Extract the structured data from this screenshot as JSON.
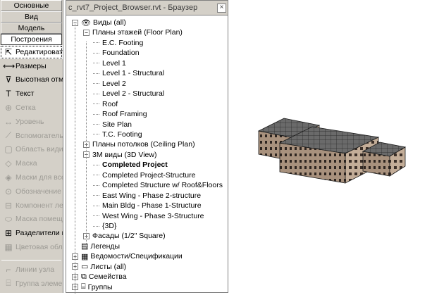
{
  "tabs": [
    "Основные",
    "Вид",
    "Модель",
    "Построения"
  ],
  "tools": [
    {
      "label": "Редактировать",
      "icon": "cursor-arrow-icon",
      "glyph": "⇱",
      "state": "selected"
    },
    {
      "label": "Размеры",
      "icon": "dimension-icon",
      "glyph": "⟷",
      "state": "enabled"
    },
    {
      "label": "Высотная отм",
      "icon": "spot-elevation-icon",
      "glyph": "⊽",
      "state": "enabled"
    },
    {
      "label": "Текст",
      "icon": "text-icon",
      "glyph": "T",
      "state": "enabled"
    },
    {
      "label": "Сетка",
      "icon": "grid-icon",
      "glyph": "⊕",
      "state": "disabled"
    },
    {
      "label": "Уровень",
      "icon": "level-icon",
      "glyph": "↔",
      "state": "disabled"
    },
    {
      "label": "Вспомогатель",
      "icon": "ref-plane-icon",
      "glyph": "⟋",
      "state": "disabled"
    },
    {
      "label": "Область види",
      "icon": "scope-box-icon",
      "glyph": "▢",
      "state": "disabled"
    },
    {
      "label": "Маска",
      "icon": "mask-icon",
      "glyph": "◇",
      "state": "disabled"
    },
    {
      "label": "Маски для все",
      "icon": "mask-all-icon",
      "glyph": "◈",
      "state": "disabled"
    },
    {
      "label": "Обозначение",
      "icon": "symbol-icon",
      "glyph": "⊙",
      "state": "disabled"
    },
    {
      "label": "Компонент ле",
      "icon": "detail-component-icon",
      "glyph": "⊟",
      "state": "disabled"
    },
    {
      "label": "Маска помещ",
      "icon": "room-mask-icon",
      "glyph": "⬭",
      "state": "disabled"
    },
    {
      "label": "Разделители г",
      "icon": "separator-icon",
      "glyph": "⊞",
      "state": "enabled"
    },
    {
      "label": "Цветовая обл",
      "icon": "color-fill-icon",
      "glyph": "▦",
      "state": "disabled"
    },
    {
      "label": "Линии узла",
      "icon": "detail-lines-icon",
      "glyph": "⌐",
      "state": "disabled"
    },
    {
      "label": "Группа элемен",
      "icon": "group-icon",
      "glyph": "⌸",
      "state": "disabled"
    }
  ],
  "browser": {
    "title": "c_rvt7_Project_Browser.rvt - Браузер",
    "close": "×",
    "nodes": [
      {
        "level": 0,
        "label": "Виды (all)",
        "toggle": "−",
        "icon": "eyes-icon",
        "glyph": "👁",
        "bold": false
      },
      {
        "level": 1,
        "label": "Планы этажей (Floor Plan)",
        "toggle": "−",
        "bold": false
      },
      {
        "level": 2,
        "label": "E.C. Footing",
        "toggle": "",
        "bold": false
      },
      {
        "level": 2,
        "label": "Foundation",
        "toggle": "",
        "bold": false
      },
      {
        "level": 2,
        "label": "Level 1",
        "toggle": "",
        "bold": false
      },
      {
        "level": 2,
        "label": "Level 1 - Structural",
        "toggle": "",
        "bold": false
      },
      {
        "level": 2,
        "label": "Level 2",
        "toggle": "",
        "bold": false
      },
      {
        "level": 2,
        "label": "Level 2 - Structural",
        "toggle": "",
        "bold": false
      },
      {
        "level": 2,
        "label": "Roof",
        "toggle": "",
        "bold": false
      },
      {
        "level": 2,
        "label": "Roof Framing",
        "toggle": "",
        "bold": false
      },
      {
        "level": 2,
        "label": "Site Plan",
        "toggle": "",
        "bold": false
      },
      {
        "level": 2,
        "label": "T.C. Footing",
        "toggle": "",
        "bold": false
      },
      {
        "level": 1,
        "label": "Планы потолков (Ceiling Plan)",
        "toggle": "+",
        "bold": false
      },
      {
        "level": 1,
        "label": "3М виды (3D View)",
        "toggle": "−",
        "bold": false
      },
      {
        "level": 2,
        "label": "Completed Project",
        "toggle": "",
        "bold": true
      },
      {
        "level": 2,
        "label": "Completed Project-Structure",
        "toggle": "",
        "bold": false
      },
      {
        "level": 2,
        "label": "Completed Structure w/ Roof&Floors",
        "toggle": "",
        "bold": false
      },
      {
        "level": 2,
        "label": "East Wing - Phase 2-structure",
        "toggle": "",
        "bold": false
      },
      {
        "level": 2,
        "label": "Main Bldg - Phase 1-Structure",
        "toggle": "",
        "bold": false
      },
      {
        "level": 2,
        "label": "West Wing - Phase 3-Structure",
        "toggle": "",
        "bold": false
      },
      {
        "level": 2,
        "label": "{3D}",
        "toggle": "",
        "bold": false
      },
      {
        "level": 1,
        "label": "Фасады (1/2\" Square)",
        "toggle": "+",
        "bold": false
      },
      {
        "level": 0,
        "label": "Легенды",
        "toggle": "",
        "icon": "legend-icon",
        "glyph": "▤",
        "bold": false
      },
      {
        "level": 0,
        "label": "Ведомости/Спецификации",
        "toggle": "+",
        "icon": "schedule-icon",
        "glyph": "▦",
        "bold": false
      },
      {
        "level": 0,
        "label": "Листы (all)",
        "toggle": "+",
        "icon": "sheet-icon",
        "glyph": "▭",
        "bold": false
      },
      {
        "level": 0,
        "label": "Семейства",
        "toggle": "+",
        "icon": "families-icon",
        "glyph": "⧉",
        "bold": false
      },
      {
        "level": 0,
        "label": "Группы",
        "toggle": "+",
        "icon": "groups-icon",
        "glyph": "⌸",
        "bold": false
      }
    ]
  },
  "colors": {
    "panel": "#d4d0c8",
    "brick": "#b9a591",
    "roof": "#5a5a5a"
  }
}
